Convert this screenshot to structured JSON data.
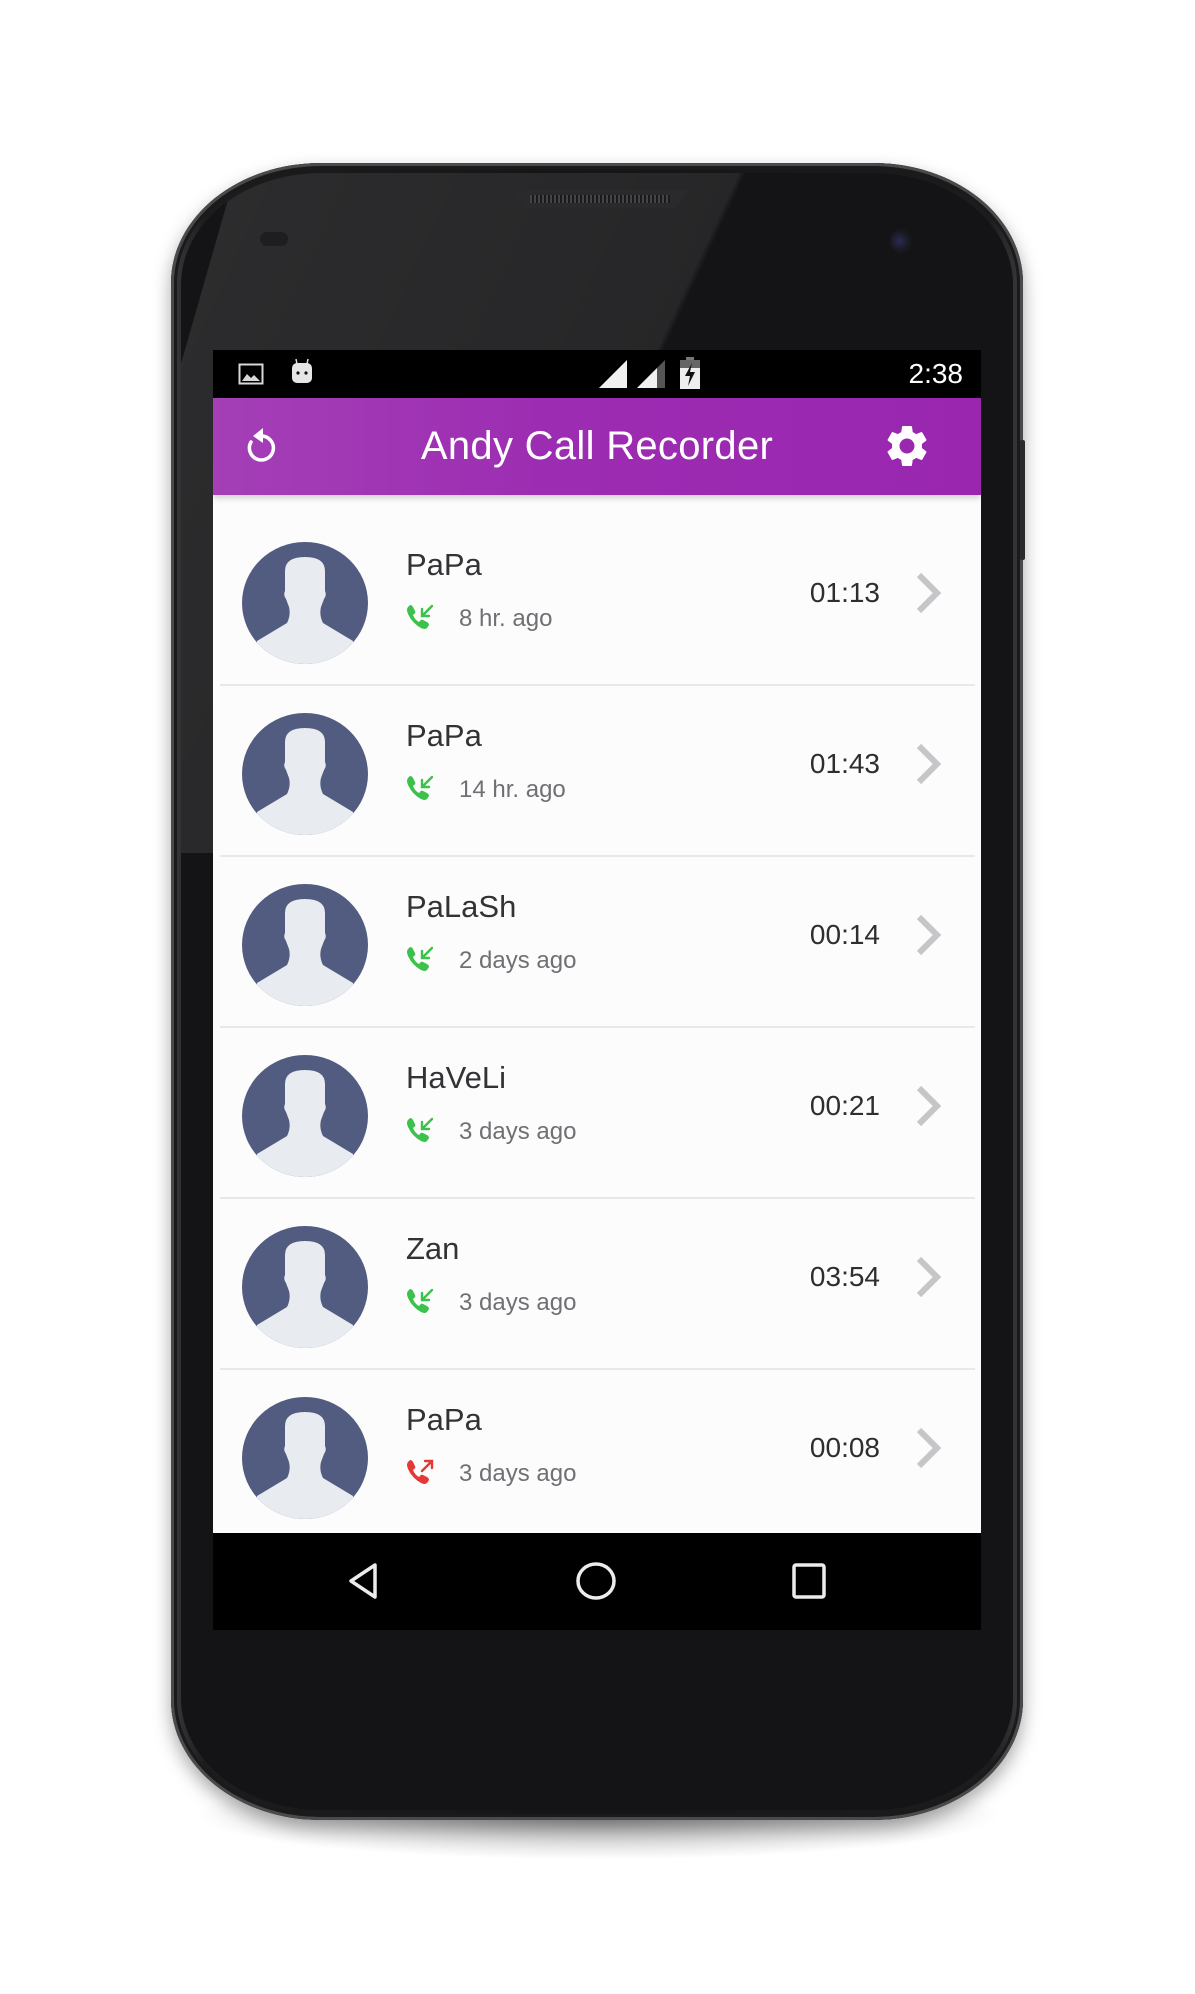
{
  "status_bar": {
    "time": "2:38",
    "left_icons": [
      "image-notification-icon",
      "android-notification-icon"
    ],
    "right_icons": [
      "signal-icon",
      "signal-icon",
      "battery-charging-icon"
    ]
  },
  "appbar": {
    "title": "Andy Call Recorder",
    "left_icon": "refresh-icon",
    "right_icon": "gear-icon"
  },
  "colors": {
    "appbar": "#9c27b0",
    "incoming": "#3cc24b",
    "outgoing": "#e53935",
    "avatar_bg": "#525c80",
    "avatar_fg": "#e8ebef",
    "chevron": "#c6c6c8"
  },
  "recordings": [
    {
      "name": "PaPa",
      "call_type": "incoming",
      "ago": "8 hr. ago",
      "duration": "01:13"
    },
    {
      "name": "PaPa",
      "call_type": "incoming",
      "ago": "14 hr. ago",
      "duration": "01:43"
    },
    {
      "name": "PaLaSh",
      "call_type": "incoming",
      "ago": "2 days ago",
      "duration": "00:14"
    },
    {
      "name": "HaVeLi",
      "call_type": "incoming",
      "ago": "3 days ago",
      "duration": "00:21"
    },
    {
      "name": "Zan",
      "call_type": "incoming",
      "ago": "3 days ago",
      "duration": "03:54"
    },
    {
      "name": "PaPa",
      "call_type": "outgoing",
      "ago": "3 days ago",
      "duration": "00:08"
    }
  ],
  "nav_bar": {
    "buttons": [
      "back-icon",
      "home-icon",
      "recents-icon"
    ]
  }
}
